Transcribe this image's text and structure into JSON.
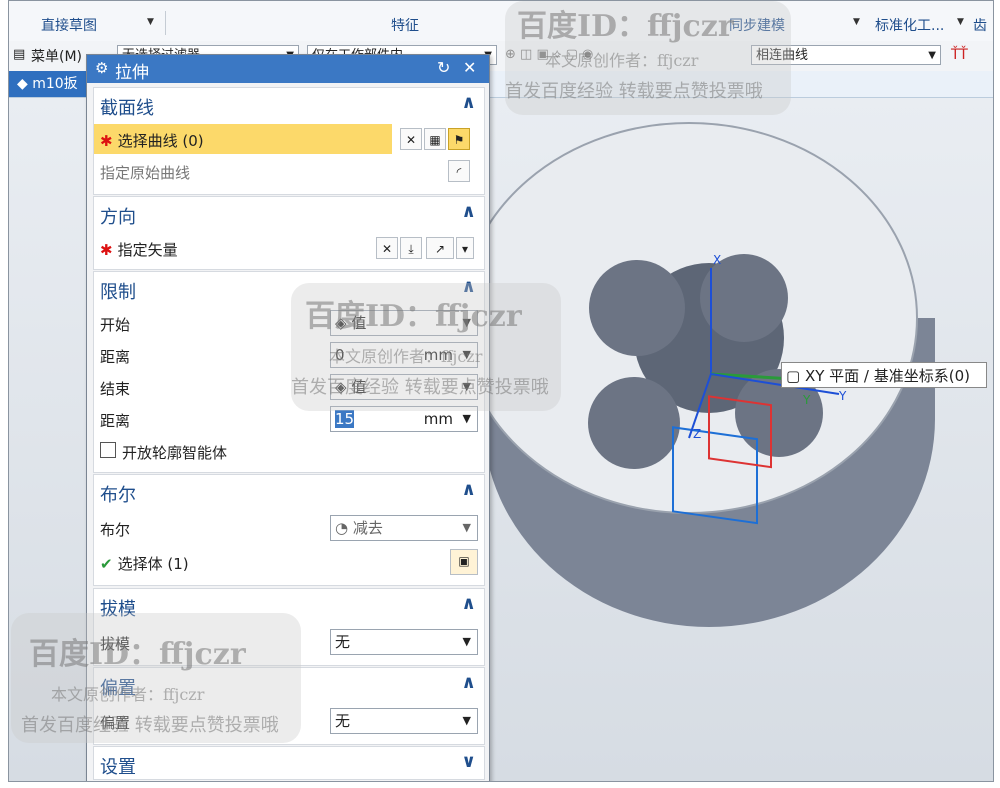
{
  "ribbon": {
    "group_direct_sketch": "直接草图",
    "group_feature": "特征",
    "group_sync_model": "同步建模",
    "group_standardize": "标准化工...",
    "group_gear": "齿"
  },
  "toolbar": {
    "menu_label": "菜单(M)",
    "filter_value": "无选择过滤器",
    "scope_value": "仅在工作部件内",
    "curve_rule_value": "相连曲线"
  },
  "tab": {
    "label": "m10扳"
  },
  "dialog": {
    "title": "拉伸",
    "sections": {
      "section_curve": {
        "title": "截面线",
        "select_curve": "选择曲线 (0)",
        "specify_origin": "指定原始曲线"
      },
      "direction": {
        "title": "方向",
        "specify_vector": "指定矢量"
      },
      "limits": {
        "title": "限制",
        "start_label": "开始",
        "start_value": "值",
        "distance1_label": "距离",
        "distance1_value": "0",
        "distance1_unit": "mm",
        "end_label": "结束",
        "end_value": "值",
        "distance2_label": "距离",
        "distance2_value": "15",
        "distance2_unit": "mm",
        "open_profile": "开放轮廓智能体"
      },
      "boolean": {
        "title": "布尔",
        "bool_label": "布尔",
        "bool_value": "减去",
        "select_body": "选择体 (1)"
      },
      "draft": {
        "title": "拔模",
        "draft_label": "拔模",
        "draft_value": "无"
      },
      "offset": {
        "title": "偏置",
        "offset_label": "偏置",
        "offset_value": "无"
      },
      "settings": {
        "title": "设置"
      }
    }
  },
  "viewport": {
    "tooltip": "XY 平面 / 基准坐标系(0)",
    "axis_x": "X",
    "axis_y": "Y",
    "axis_y2": "Y",
    "axis_z": "Z"
  },
  "watermark": {
    "id_line": "百度ID：ffjczr",
    "author_line": "本文原创作者：ffjczr",
    "publish_line": "首发百度经验 转载要点赞投票哦"
  },
  "colors": {
    "accent": "#3b78c4",
    "highlight": "#fcd96a",
    "part": "#8e98a8"
  }
}
